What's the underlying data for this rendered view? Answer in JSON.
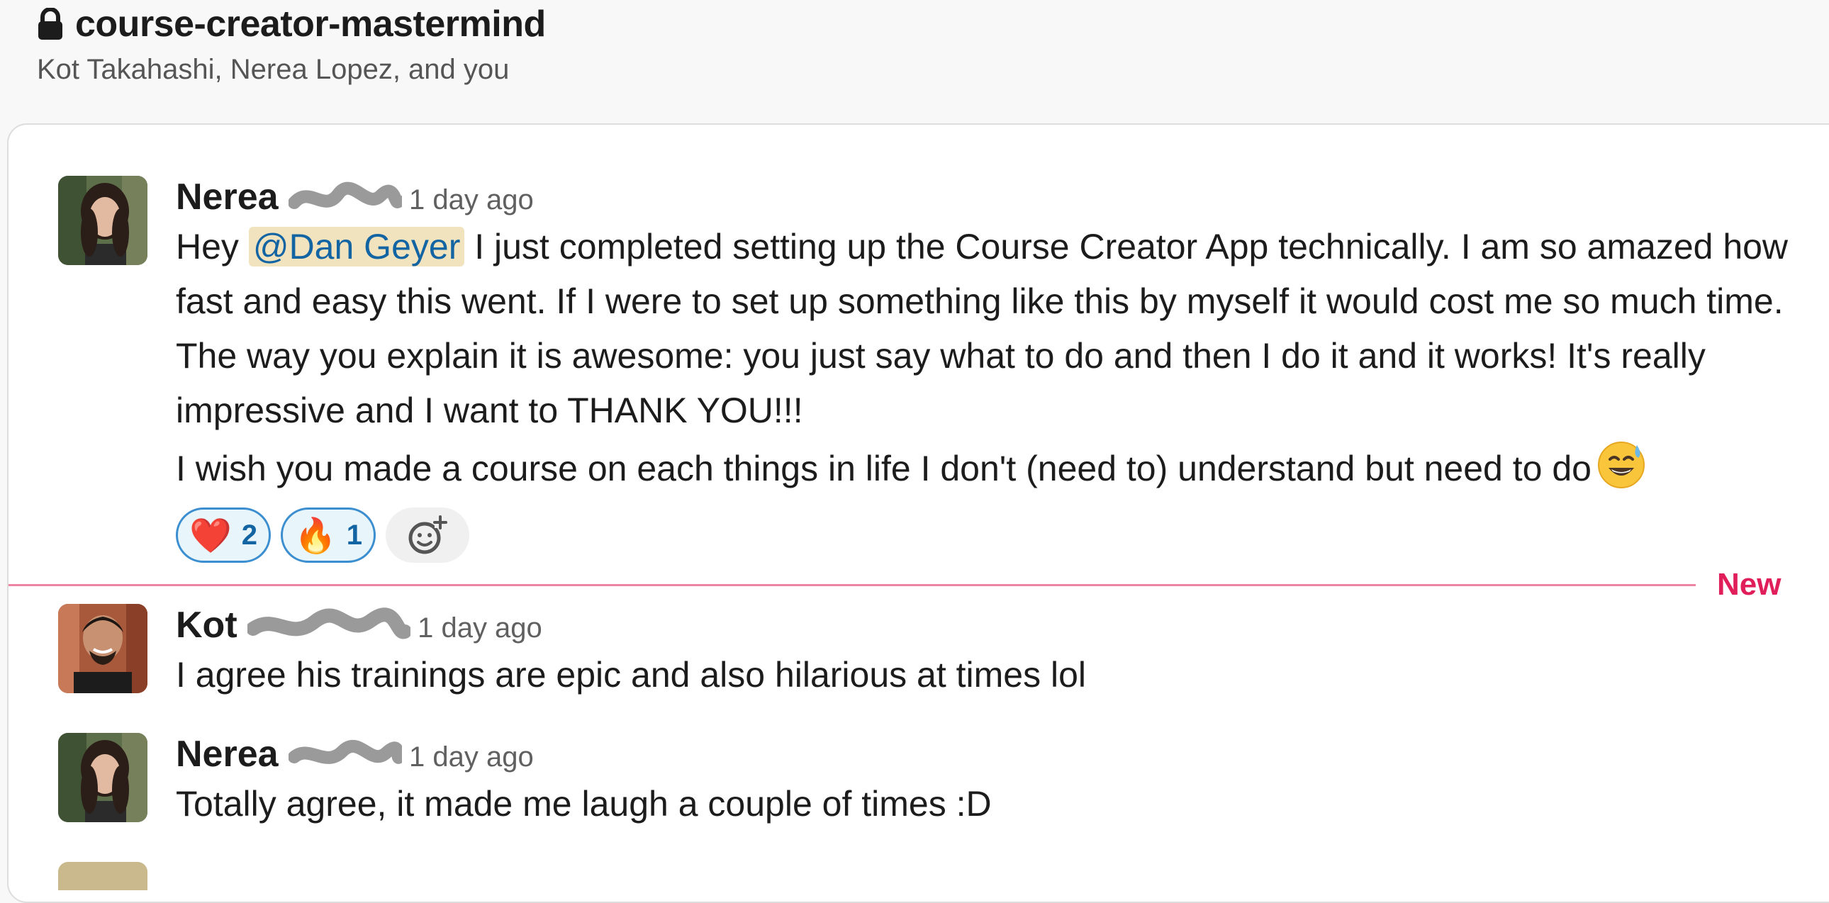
{
  "channel": {
    "name": "course-creator-mastermind",
    "members": "Kot Takahashi, Nerea Lopez, and you"
  },
  "messages": [
    {
      "author_first": "Nerea",
      "timestamp": "1 day ago",
      "mention": "@Dan Geyer",
      "text_before_mention": "Hey ",
      "text_after_mention": " I just completed setting up the Course Creator App technically. I am so amazed how fast and easy this went. If I were to set up something like this by myself it would cost me so much time. The way you explain it is awesome: you just say what to do and then I do it and it works! It's really impressive and I want to THANK YOU!!!",
      "text_second_line": "I wish you made a course on each things in life I don't (need to) understand but need to do",
      "inline_emoji": "sweat-smile-icon",
      "reactions": [
        {
          "emoji": "❤️",
          "icon": "heart-icon",
          "count": "2"
        },
        {
          "emoji": "🔥",
          "icon": "fire-icon",
          "count": "1"
        }
      ]
    },
    {
      "author_first": "Kot",
      "timestamp": "1 day ago",
      "text": "I agree his trainings are epic and also hilarious at times lol"
    },
    {
      "author_first": "Nerea",
      "timestamp": "1 day ago",
      "text": "Totally agree, it made me laugh a couple of times :D"
    }
  ],
  "divider": {
    "label": "New",
    "color": "#e01e5a"
  },
  "colors": {
    "mention_bg": "#f2e3bf",
    "mention_text": "#1264a3",
    "reaction_border": "#3b8ed0",
    "reaction_bg": "#e8f5fa"
  }
}
